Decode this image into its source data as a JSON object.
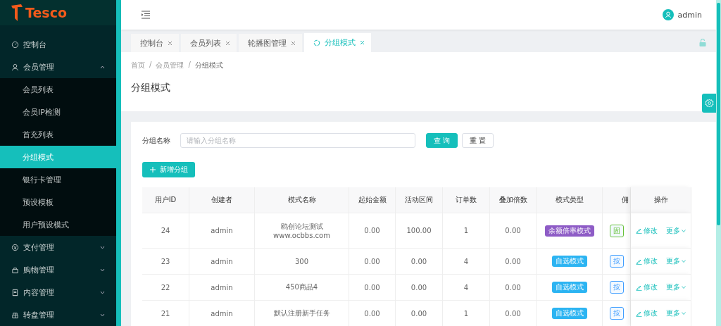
{
  "logo": {
    "text": "Tesco"
  },
  "menu": [
    {
      "label": "控制台",
      "kind": "link"
    },
    {
      "label": "会员管理",
      "kind": "group",
      "expanded": true,
      "children": [
        {
          "label": "会员列表",
          "selected": false
        },
        {
          "label": "会员IP检测",
          "selected": false
        },
        {
          "label": "首充列表",
          "selected": false
        },
        {
          "label": "分组模式",
          "selected": true
        },
        {
          "label": "银行卡管理",
          "selected": false
        },
        {
          "label": "预设模板",
          "selected": false
        },
        {
          "label": "用户预设模式",
          "selected": false
        }
      ]
    },
    {
      "label": "支付管理",
      "kind": "group",
      "expanded": false
    },
    {
      "label": "购物管理",
      "kind": "group",
      "expanded": false
    },
    {
      "label": "内容管理",
      "kind": "group",
      "expanded": false
    },
    {
      "label": "转盘管理",
      "kind": "group",
      "expanded": false
    }
  ],
  "user": {
    "name": "admin"
  },
  "tabs": [
    {
      "label": "控制台",
      "selected": false
    },
    {
      "label": "会员列表",
      "selected": false
    },
    {
      "label": "轮播图管理",
      "selected": false
    },
    {
      "label": "分组模式",
      "selected": true
    }
  ],
  "breadcrumb": [
    "首页",
    "会员管理",
    "分组模式"
  ],
  "breadcrumb_separator": "/",
  "page_title": "分组模式",
  "filter": {
    "label": "分组名称",
    "placeholder": "请输入分组名称",
    "search_button": "查 询",
    "reset_button": "重 置"
  },
  "add_button": "新增分组",
  "table": {
    "columns": [
      "用户ID",
      "创建者",
      "模式名称",
      "起始金额",
      "活动区间",
      "订单数",
      "叠加倍数",
      "模式类型",
      "佣",
      "操作"
    ],
    "rows": [
      {
        "id": "24",
        "creator": "admin",
        "name": [
          "鸥创论坛测试",
          "www.ocbbs.com"
        ],
        "start": "0.00",
        "range": "100.00",
        "orders": "1",
        "multiplier": "0.00",
        "type": {
          "text": "余额倍率模式",
          "color": "#8e5cc6"
        },
        "commission": {
          "text": "固",
          "color": "#67c23a"
        },
        "actions": [
          "修改",
          "更多"
        ]
      },
      {
        "id": "23",
        "creator": "admin",
        "name": [
          "300"
        ],
        "start": "0.00",
        "range": "0.00",
        "orders": "4",
        "multiplier": "0.00",
        "type": {
          "text": "自选模式",
          "color": "#2cb4f2"
        },
        "commission": {
          "text": "按",
          "color": "#409eff"
        },
        "actions": [
          "修改",
          "更多"
        ]
      },
      {
        "id": "22",
        "creator": "admin",
        "name": [
          "450商品4"
        ],
        "start": "0.00",
        "range": "0.00",
        "orders": "4",
        "multiplier": "0.00",
        "type": {
          "text": "自选模式",
          "color": "#2cb4f2"
        },
        "commission": {
          "text": "按",
          "color": "#409eff"
        },
        "actions": [
          "修改",
          "更多"
        ]
      },
      {
        "id": "21",
        "creator": "admin",
        "name": [
          "默认注册新手任务"
        ],
        "start": "0.00",
        "range": "0.00",
        "orders": "1",
        "multiplier": "0.00",
        "type": {
          "text": "自选模式",
          "color": "#2cb4f2"
        },
        "commission": {
          "text": "按",
          "color": "#409eff"
        },
        "actions": [
          "修改",
          "更多"
        ]
      }
    ]
  }
}
